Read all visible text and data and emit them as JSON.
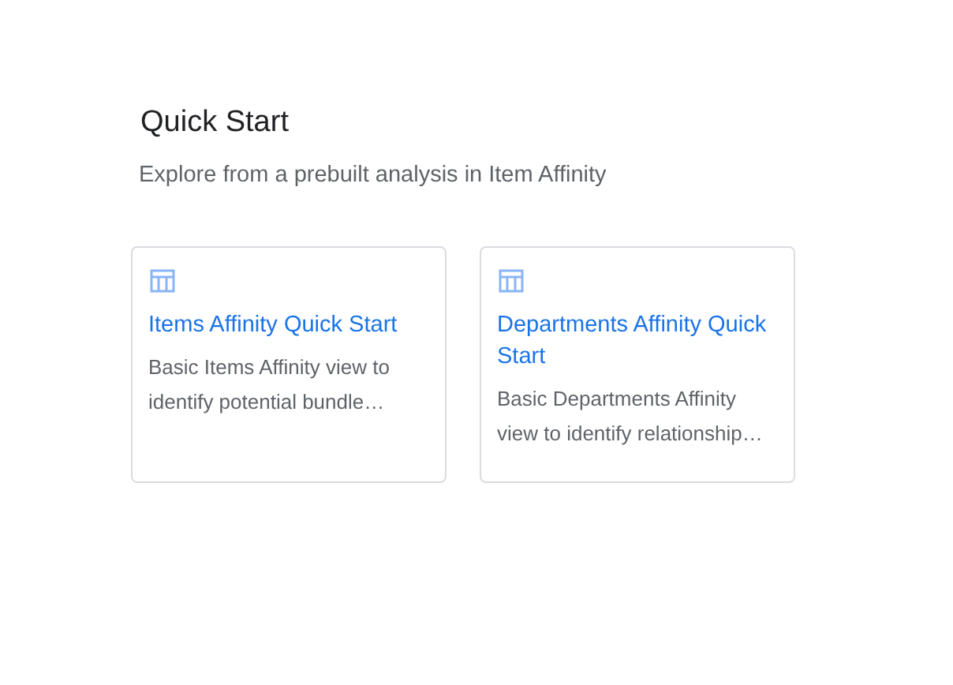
{
  "heading": "Quick Start",
  "subtitle": "Explore from a prebuilt analysis in Item Affinity",
  "cards": [
    {
      "title": "Items Affinity Quick Start",
      "description": "Basic Items Affinity view to identify potential bundle…"
    },
    {
      "title": "Departments Affinity Quick Start",
      "description": "Basic Departments Affinity view to identify relationship…"
    }
  ]
}
